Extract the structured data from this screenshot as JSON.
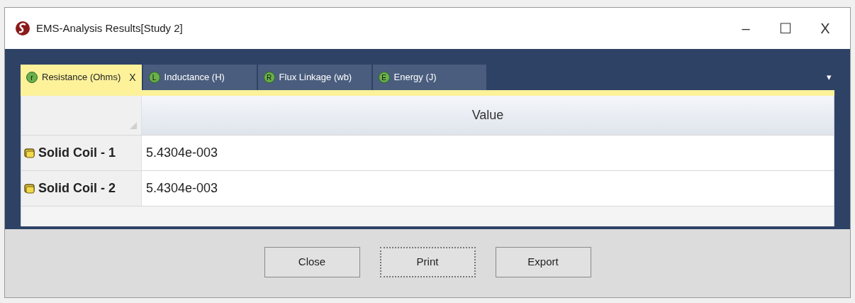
{
  "window": {
    "title": "EMS-Analysis Results[Study 2]",
    "controls": [
      "–",
      "☐",
      "X"
    ]
  },
  "tabs": [
    {
      "badge": "r",
      "label": "Resistance (Ohms)",
      "close": "X",
      "selected": true
    },
    {
      "badge": "L",
      "label": "Inductance (H)",
      "selected": false
    },
    {
      "badge": "R",
      "label": "Flux Linkage (wb)",
      "selected": false
    },
    {
      "badge": "E",
      "label": "Energy (J)",
      "selected": false
    }
  ],
  "tab_menu": "▾",
  "table": {
    "columns": [
      "Value"
    ],
    "rows": [
      {
        "name": "Solid Coil - 1",
        "value": "5.4304e-003"
      },
      {
        "name": "Solid Coil - 2",
        "value": "5.4304e-003"
      }
    ]
  },
  "buttons": [
    {
      "label": "Close",
      "focused": false
    },
    {
      "label": "Print",
      "focused": true
    },
    {
      "label": "Export",
      "focused": false
    }
  ]
}
